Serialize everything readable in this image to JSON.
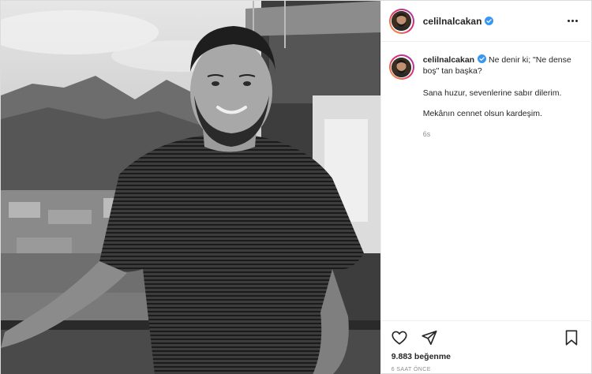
{
  "post": {
    "username": "celilnalcakan",
    "photo_icon": "portrait-photo",
    "caption": {
      "username": "celilnalcakan",
      "line1": "Ne denir ki; \"Ne dense boş\" tan başka?",
      "paragraph1": "Sana huzur, sevenlerine sabır dilerim.",
      "paragraph2": "Mekânın cennet olsun kardeşim.",
      "timestamp": "6s"
    },
    "likes": "9.883 beğenme",
    "time_ago": "6 SAAT ÖNCE",
    "icons": {
      "more": "more-options-icon",
      "verified": "verified-badge-icon",
      "like": "heart-icon",
      "share": "paper-plane-icon",
      "save": "bookmark-icon"
    },
    "colors": {
      "verified": "#3897f0",
      "text": "#262626",
      "muted": "#8e8e8e",
      "border": "#efefef"
    }
  }
}
